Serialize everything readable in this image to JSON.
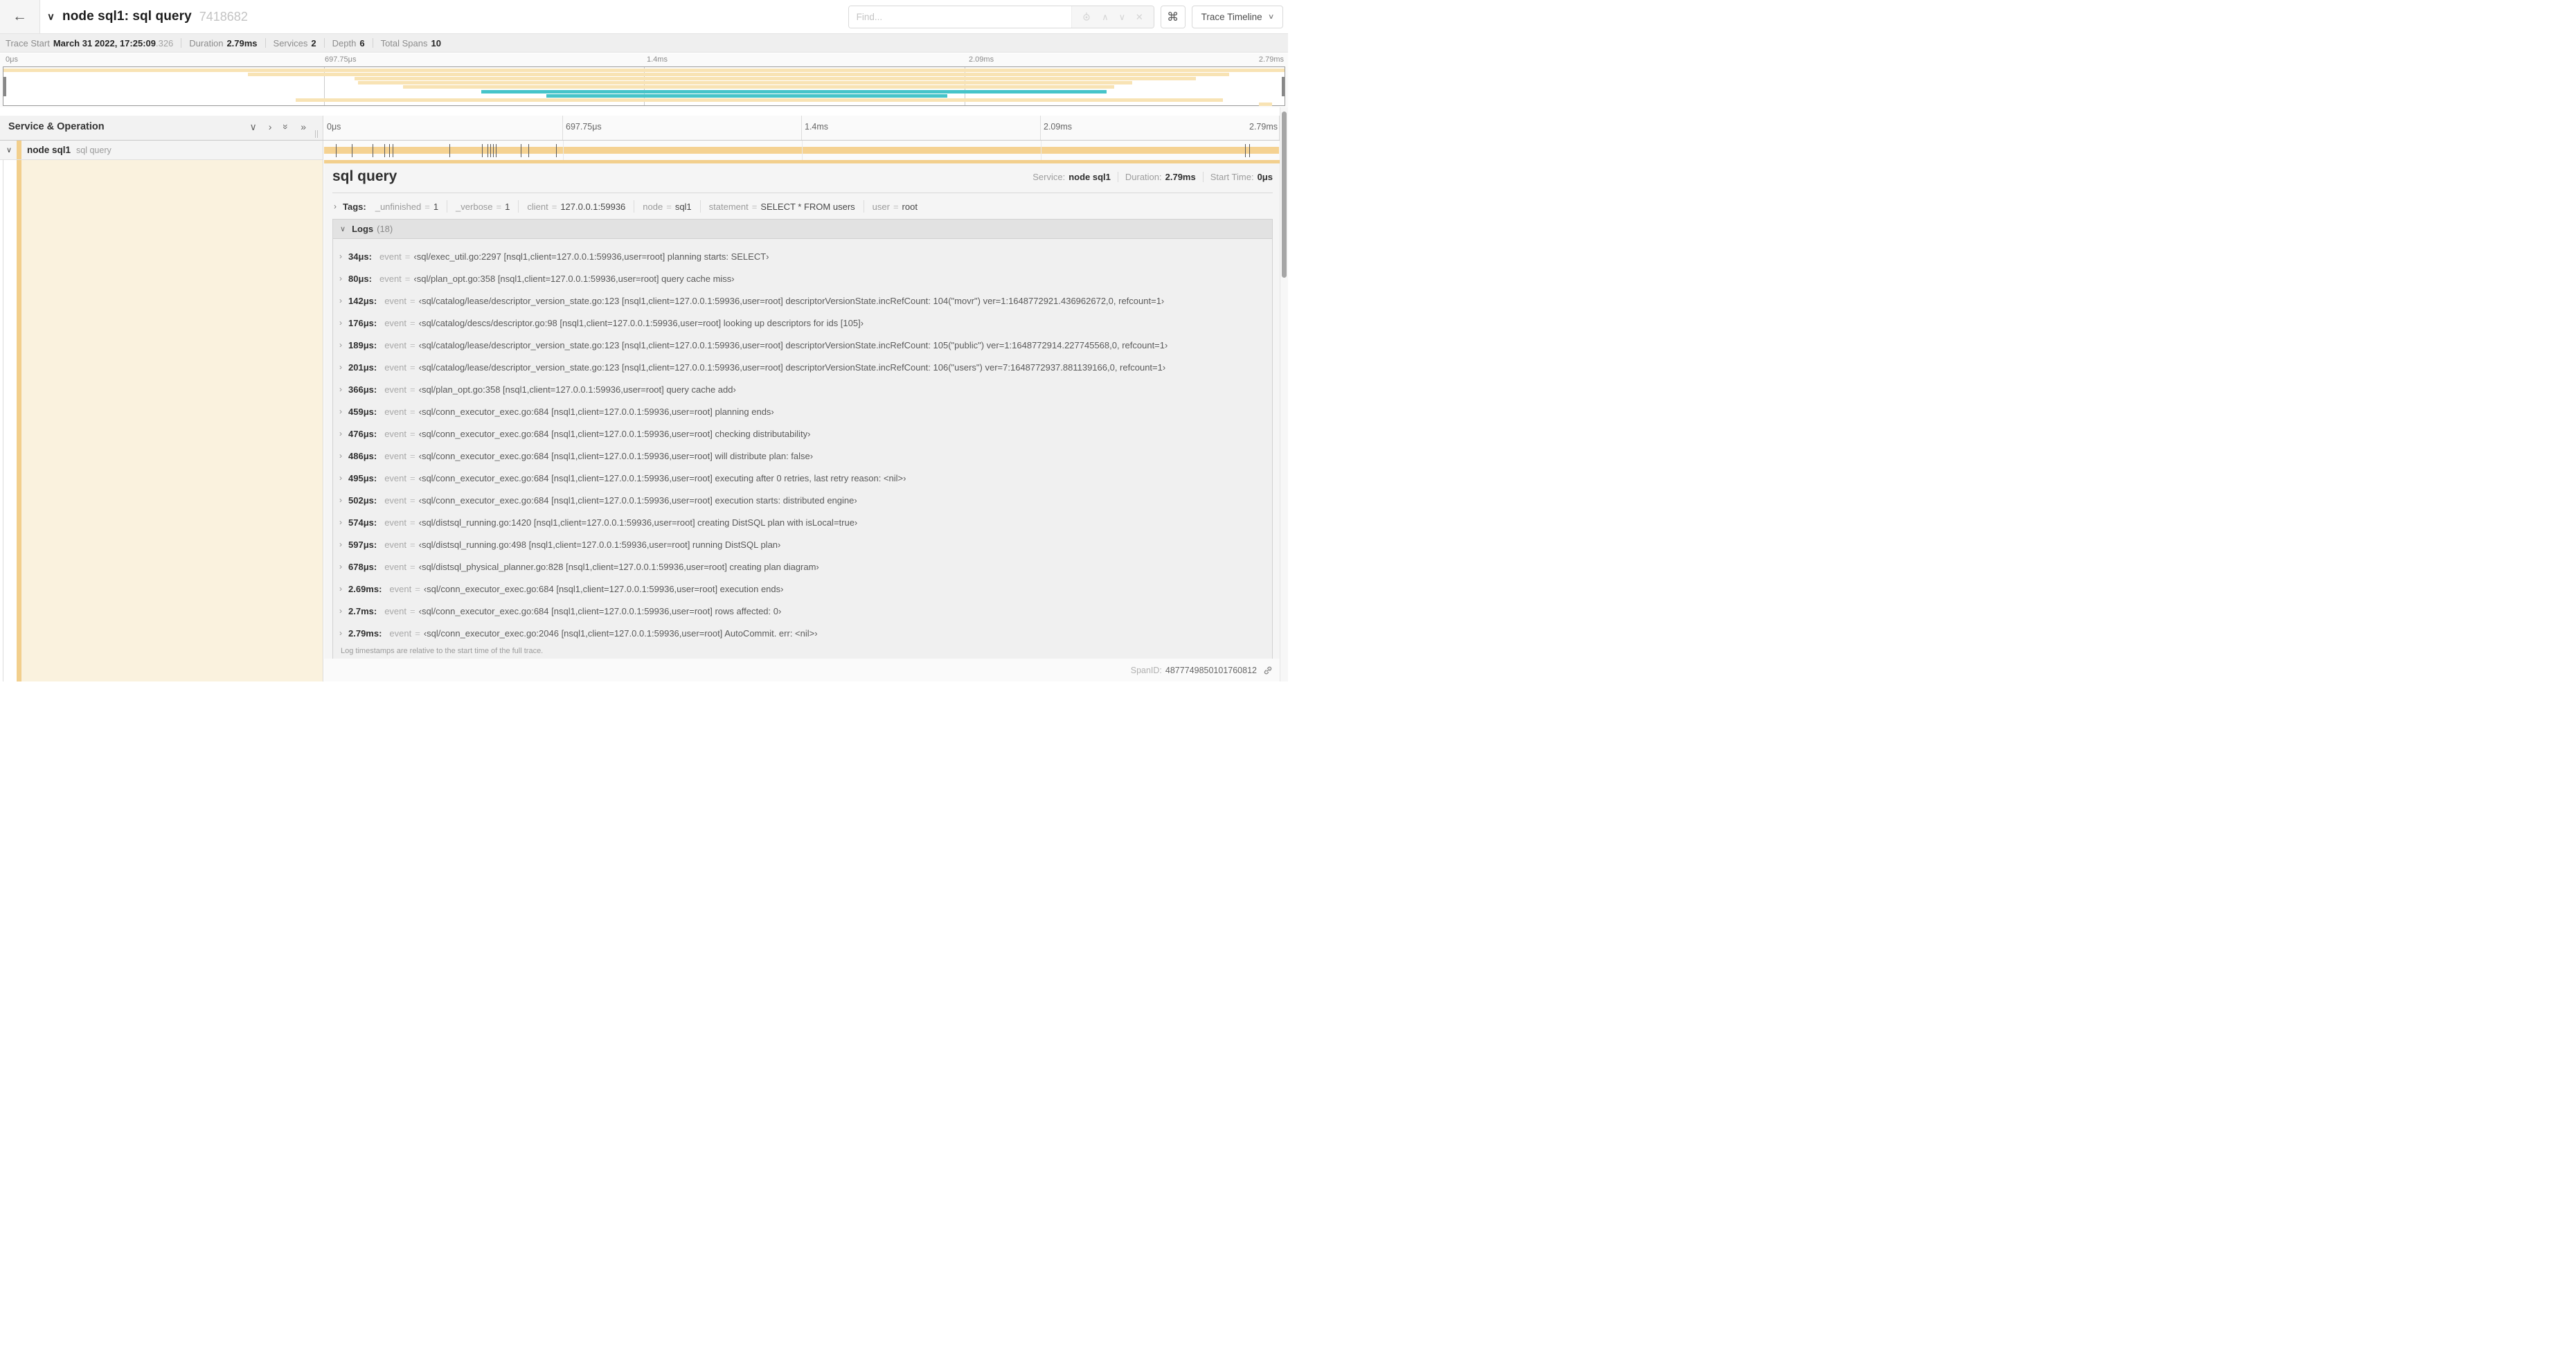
{
  "header": {
    "back_icon": "←",
    "collapse_chevron": "∨",
    "title": "node sql1: sql query",
    "trace_id": "7418682",
    "find_placeholder": "Find...",
    "shortcut_button": "⌘",
    "view_selector": "Trace Timeline"
  },
  "summary": {
    "items": [
      {
        "label": "Trace Start",
        "value": "March 31 2022, 17:25:09",
        "suffix": ".326"
      },
      {
        "label": "Duration",
        "value": "2.79ms"
      },
      {
        "label": "Services",
        "value": "2"
      },
      {
        "label": "Depth",
        "value": "6"
      },
      {
        "label": "Total Spans",
        "value": "10"
      }
    ]
  },
  "timeline": {
    "ruler_labels": [
      "0μs",
      "697.75μs",
      "1.4ms",
      "2.09ms",
      "2.79ms"
    ],
    "ruler_pcts": [
      0,
      25,
      50,
      75,
      100
    ],
    "colors": {
      "tan": "#f2cf8d",
      "tan_bar": "#f5d292",
      "tan_light": "#f8e3b4",
      "teal": "#46c4c9",
      "cream": "#faf2de"
    },
    "minimap_spans": [
      {
        "start": 0,
        "end": 100,
        "color": "tan_light"
      },
      {
        "start": 19.1,
        "end": 95.7,
        "color": "tan_light"
      },
      {
        "start": 27.4,
        "end": 93.1,
        "color": "tan_light"
      },
      {
        "start": 27.7,
        "end": 88.1,
        "color": "tan_light"
      },
      {
        "start": 31.2,
        "end": 86.7,
        "color": "tan_light"
      },
      {
        "start": 37.3,
        "end": 86.1,
        "color": "teal"
      },
      {
        "start": 42.4,
        "end": 73.7,
        "color": "teal"
      },
      {
        "start": 22.8,
        "end": 95.2,
        "color": "tan_light"
      },
      {
        "start": 98.0,
        "end": 99.0,
        "color": "tan_light"
      }
    ],
    "service_operation_label": "Service & Operation",
    "row": {
      "service": "node sql1",
      "operation": "sql query"
    },
    "log_marks_pct": [
      1.2,
      2.9,
      5.1,
      6.3,
      6.8,
      7.2,
      13.1,
      16.5,
      17.1,
      17.4,
      17.7,
      18.0,
      20.6,
      21.4,
      24.3,
      96.4,
      96.8
    ]
  },
  "detail": {
    "operation": "sql query",
    "meta": [
      {
        "label": "Service:",
        "value": "node sql1"
      },
      {
        "label": "Duration:",
        "value": "2.79ms"
      },
      {
        "label": "Start Time:",
        "value": "0μs"
      }
    ],
    "tags_label": "Tags:",
    "tags": [
      {
        "key": "_unfinished",
        "value": "1"
      },
      {
        "key": "_verbose",
        "value": "1"
      },
      {
        "key": "client",
        "value": "127.0.0.1:59936"
      },
      {
        "key": "node",
        "value": "sql1"
      },
      {
        "key": "statement",
        "value": "SELECT * FROM users"
      },
      {
        "key": "user",
        "value": "root"
      }
    ],
    "logs_label": "Logs",
    "logs_count": "(18)",
    "log_key": "event",
    "logs": [
      {
        "time": "34μs:",
        "value": "‹sql/exec_util.go:2297 [nsql1,client=127.0.0.1:59936,user=root] planning starts: SELECT›"
      },
      {
        "time": "80μs:",
        "value": "‹sql/plan_opt.go:358 [nsql1,client=127.0.0.1:59936,user=root] query cache miss›"
      },
      {
        "time": "142μs:",
        "value": "‹sql/catalog/lease/descriptor_version_state.go:123 [nsql1,client=127.0.0.1:59936,user=root] descriptorVersionState.incRefCount: 104(\"movr\") ver=1:1648772921.436962672,0, refcount=1›"
      },
      {
        "time": "176μs:",
        "value": "‹sql/catalog/descs/descriptor.go:98 [nsql1,client=127.0.0.1:59936,user=root] looking up descriptors for ids [105]›"
      },
      {
        "time": "189μs:",
        "value": "‹sql/catalog/lease/descriptor_version_state.go:123 [nsql1,client=127.0.0.1:59936,user=root] descriptorVersionState.incRefCount: 105(\"public\") ver=1:1648772914.227745568,0, refcount=1›"
      },
      {
        "time": "201μs:",
        "value": "‹sql/catalog/lease/descriptor_version_state.go:123 [nsql1,client=127.0.0.1:59936,user=root] descriptorVersionState.incRefCount: 106(\"users\") ver=7:1648772937.881139166,0, refcount=1›"
      },
      {
        "time": "366μs:",
        "value": "‹sql/plan_opt.go:358 [nsql1,client=127.0.0.1:59936,user=root] query cache add›"
      },
      {
        "time": "459μs:",
        "value": "‹sql/conn_executor_exec.go:684 [nsql1,client=127.0.0.1:59936,user=root] planning ends›"
      },
      {
        "time": "476μs:",
        "value": "‹sql/conn_executor_exec.go:684 [nsql1,client=127.0.0.1:59936,user=root] checking distributability›"
      },
      {
        "time": "486μs:",
        "value": "‹sql/conn_executor_exec.go:684 [nsql1,client=127.0.0.1:59936,user=root] will distribute plan: false›"
      },
      {
        "time": "495μs:",
        "value": "‹sql/conn_executor_exec.go:684 [nsql1,client=127.0.0.1:59936,user=root] executing after 0 retries, last retry reason: <nil>›"
      },
      {
        "time": "502μs:",
        "value": "‹sql/conn_executor_exec.go:684 [nsql1,client=127.0.0.1:59936,user=root] execution starts: distributed engine›"
      },
      {
        "time": "574μs:",
        "value": "‹sql/distsql_running.go:1420 [nsql1,client=127.0.0.1:59936,user=root] creating DistSQL plan with isLocal=true›"
      },
      {
        "time": "597μs:",
        "value": "‹sql/distsql_running.go:498 [nsql1,client=127.0.0.1:59936,user=root] running DistSQL plan›"
      },
      {
        "time": "678μs:",
        "value": "‹sql/distsql_physical_planner.go:828 [nsql1,client=127.0.0.1:59936,user=root] creating plan diagram›"
      },
      {
        "time": "2.69ms:",
        "value": "‹sql/conn_executor_exec.go:684 [nsql1,client=127.0.0.1:59936,user=root] execution ends›"
      },
      {
        "time": "2.7ms:",
        "value": "‹sql/conn_executor_exec.go:684 [nsql1,client=127.0.0.1:59936,user=root] rows affected: 0›"
      },
      {
        "time": "2.79ms:",
        "value": "‹sql/conn_executor_exec.go:2046 [nsql1,client=127.0.0.1:59936,user=root] AutoCommit. err: <nil>›"
      }
    ],
    "logs_note": "Log timestamps are relative to the start time of the full trace.",
    "footer": {
      "label": "SpanID:",
      "value": "4877749850101760812"
    }
  }
}
